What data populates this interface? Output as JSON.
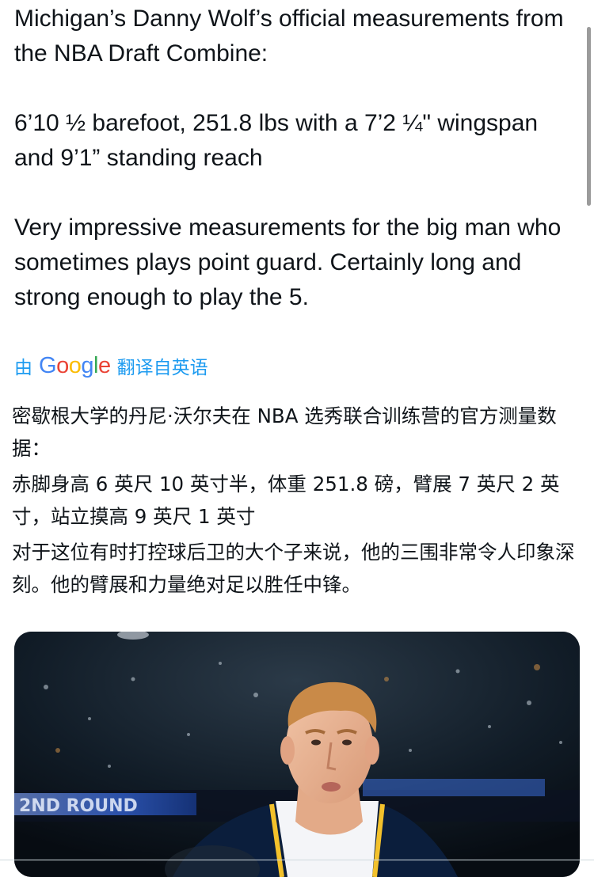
{
  "post": {
    "paragraphs": [
      "Michigan’s Danny Wolf’s official measurements from the NBA Draft Combine:",
      "6’10 ½ barefoot, 251.8 lbs with a 7’2 ¼\" wingspan and 9’1” standing reach",
      "Very impressive measurements for the big man who sometimes plays point guard. Certainly long and strong enough to play the 5."
    ]
  },
  "translation": {
    "by": "由",
    "google": "Google",
    "from": "翻译自英语",
    "paragraphs": [
      "密歇根大学的丹尼·沃尔夫在 NBA 选秀联合训练营的官方测量数据：",
      "赤脚身高 6 英尺 10 英寸半，体重 251.8 磅，臂展 7 英尺 2 英寸，站立摸高 9 英尺 1 英寸",
      "对于这位有时打控球后卫的大个子来说，他的三围非常令人印象深刻。他的臂展和力量绝对足以胜任中锋。"
    ]
  },
  "media": {
    "board_text": "2ND ROUND"
  },
  "colors": {
    "text": "#0f1419",
    "link": "#1d9bf0",
    "jersey_navy": "#0b1e3c",
    "jersey_stripe": "#f3c12b"
  }
}
